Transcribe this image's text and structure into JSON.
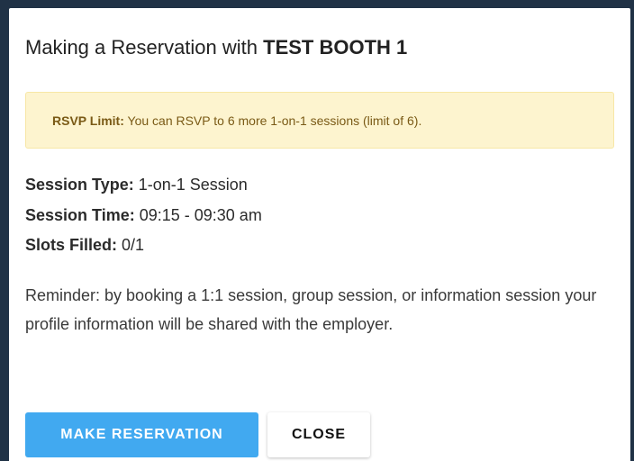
{
  "modal": {
    "title_prefix": "Making a Reservation with ",
    "booth_name": "TEST BOOTH 1"
  },
  "alert": {
    "label": "RSVP Limit:",
    "message": " You can RSVP to 6 more 1-on-1 sessions (limit of 6).",
    "bg_color": "#fdf4cf",
    "text_color": "#7a5a16"
  },
  "session": {
    "type_label": "Session Type:",
    "type_value": " 1-on-1 Session",
    "time_label": "Session Time:",
    "time_value": " 09:15 - 09:30 am",
    "slots_label": "Slots Filled:",
    "slots_value": " 0/1"
  },
  "reminder": "Reminder: by booking a 1:1 session, group session, or information session your profile information will be shared with the employer.",
  "buttons": {
    "reserve_label": "MAKE RESERVATION",
    "close_label": "CLOSE",
    "primary_color": "#41a9f0"
  },
  "backdrop_color": "#203246"
}
